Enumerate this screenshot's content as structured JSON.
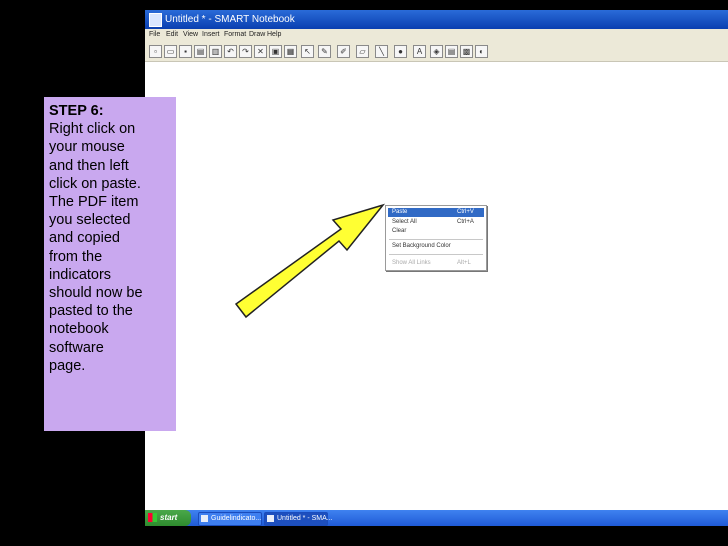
{
  "window": {
    "title": "Untitled * - SMART Notebook"
  },
  "menu": [
    "File",
    "Edit",
    "View",
    "Insert",
    "Format",
    "Draw",
    "Help"
  ],
  "toolbar_icons": [
    "new-page-icon",
    "open-icon",
    "save-icon",
    "paste-icon",
    "print-icon",
    "undo-icon",
    "redo-icon",
    "delete-icon",
    "screen-shade-icon",
    "table-icon",
    "select-icon",
    "pen-icon",
    "creative-pen-icon",
    "eraser-icon",
    "line-icon",
    "shape-icon",
    "text-icon",
    "fill-icon",
    "properties-icon",
    "capture-icon",
    "dual-page-icon"
  ],
  "context_menu": {
    "items": [
      {
        "label": "Paste",
        "shortcut": "Ctrl+V",
        "state": "highlighted"
      },
      {
        "label": "Select All",
        "shortcut": "Ctrl+A",
        "state": "normal"
      },
      {
        "label": "Clear",
        "shortcut": "",
        "state": "normal"
      },
      {
        "label": "Set Background Color",
        "shortcut": "",
        "state": "normal"
      },
      {
        "label": "Show All Links",
        "shortcut": "Alt+L",
        "state": "disabled"
      }
    ]
  },
  "step": {
    "heading": "STEP 6:",
    "body": "Right click on\nyour mouse\nand then left\nclick on paste.\nThe PDF item\nyou selected\nand copied\nfrom the\nindicators\nshould now be\npasted to the\nnotebook\nsoftware\npage."
  },
  "arrow_color": "#ffff33",
  "taskbar": {
    "start_label": "start",
    "tasks": [
      {
        "label": "Guidelindicato..."
      },
      {
        "label": "Untitled * - SMA..."
      }
    ]
  }
}
